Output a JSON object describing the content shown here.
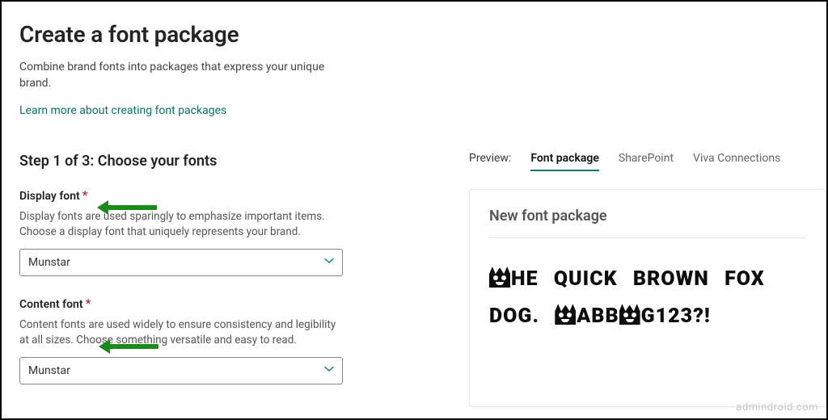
{
  "header": {
    "title": "Create a font package",
    "description": "Combine brand fonts into packages that express your unique brand.",
    "learn_link": "Learn more about creating font packages"
  },
  "step": {
    "title": "Step 1 of 3: Choose your fonts"
  },
  "fields": {
    "display": {
      "label": "Display font",
      "required": "*",
      "help": "Display fonts are used sparingly to emphasize important items. Choose a display font that uniquely represents your brand.",
      "value": "Munstar"
    },
    "content": {
      "label": "Content font",
      "required": "*",
      "help": "Content fonts are used widely to ensure consistency and legibility at all sizes. Choose something versatile and easy to read.",
      "value": "Munstar"
    }
  },
  "preview": {
    "label": "Preview:",
    "tabs": {
      "font_package": "Font package",
      "sharepoint": "SharePoint",
      "viva": "Viva Connections"
    },
    "heading": "New font package",
    "sample": {
      "w1": "HE",
      "w2": "QUICK",
      "w3": "BROWN",
      "w4": "FOX",
      "w5": "DOG.",
      "w6": "ABB",
      "w7": "G123?!"
    }
  },
  "watermark": "admindroid.com"
}
